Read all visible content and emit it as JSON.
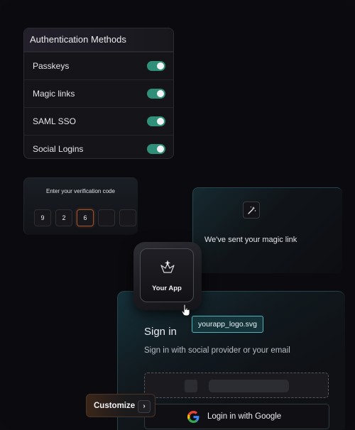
{
  "auth_methods": {
    "title": "Authentication Methods",
    "items": [
      {
        "label": "Passkeys",
        "enabled": true
      },
      {
        "label": "Magic links",
        "enabled": true
      },
      {
        "label": "SAML SSO",
        "enabled": true
      },
      {
        "label": "Social Logins",
        "enabled": true
      }
    ],
    "toggle_color": "#2f8f79"
  },
  "verification": {
    "title": "Enter your verification code",
    "digits": [
      "9",
      "2",
      "6",
      "",
      ""
    ]
  },
  "magic_link": {
    "icon": "magic-wand-icon",
    "message": "We've sent your magic link"
  },
  "app": {
    "name": "Your App",
    "icon": "crown-sparkle-icon"
  },
  "file_badge": {
    "label": "yourapp_logo.svg"
  },
  "signin": {
    "title": "Sign in",
    "subtitle": "Sign in with social provider or your email",
    "google_button": "Login in with Google"
  },
  "customize": {
    "label": "Customize",
    "chevron": "›"
  }
}
